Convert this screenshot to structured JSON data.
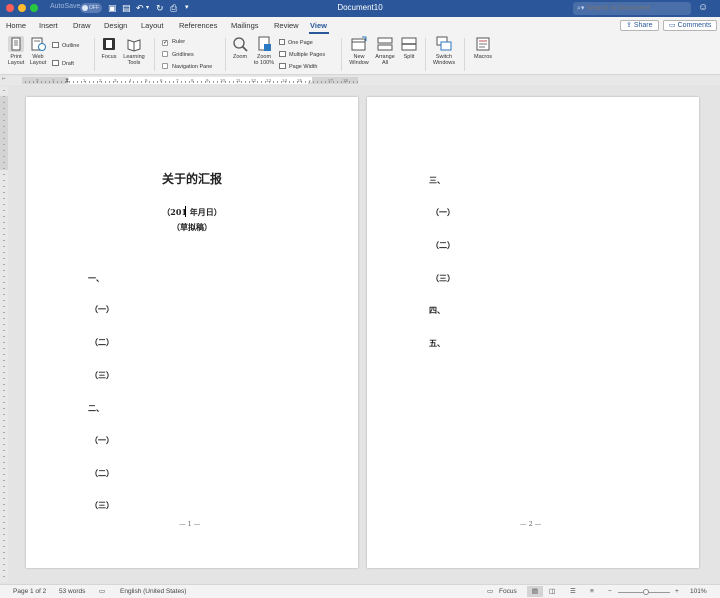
{
  "app": {
    "document_title": "Document10",
    "autosave_label": "AutoSave",
    "autosave_state": "OFF",
    "search_placeholder": "Search in Document"
  },
  "tabs": [
    "Home",
    "Insert",
    "Draw",
    "Design",
    "Layout",
    "References",
    "Mailings",
    "Review",
    "View"
  ],
  "active_tab": "View",
  "header_buttons": {
    "share": "Share",
    "comments": "Comments"
  },
  "ribbon": {
    "print_layout": [
      "Print",
      "Layout"
    ],
    "web_layout": [
      "Web",
      "Layout"
    ],
    "outline": "Outline",
    "draft": "Draft",
    "focus": "Focus",
    "learning_tools": [
      "Learning",
      "Tools"
    ],
    "ruler": "Ruler",
    "ruler_checked": true,
    "gridlines": "Gridlines",
    "gridlines_checked": false,
    "navigation_pane": "Navigation Pane",
    "navigation_pane_checked": false,
    "zoom": "Zoom",
    "zoom_100": [
      "Zoom",
      "to 100%"
    ],
    "one_page": "One Page",
    "multiple_pages": "Multiple Pages",
    "page_width": "Page Width",
    "new_window": [
      "New",
      "Window"
    ],
    "arrange_all": [
      "Arrange",
      "All"
    ],
    "split": "Split",
    "switch_windows": [
      "Switch",
      "Windows"
    ],
    "macros": "Macros"
  },
  "document": {
    "page1": {
      "title": "关于的汇报",
      "date_line": "（201 年月日）",
      "draft_line": "（草拟稿）",
      "items": [
        "一、",
        "（一）",
        "（二）",
        "（三）",
        "二、",
        "（一）",
        "（二）",
        "（三）"
      ],
      "page_number": "— 1 —"
    },
    "page2": {
      "items": [
        "三、",
        "（一）",
        "（二）",
        "（三）",
        "四、",
        "五、"
      ],
      "page_number": "— 2 —"
    }
  },
  "status": {
    "page": "Page 1 of 2",
    "words": "53 words",
    "language": "English (United States)",
    "focus": "Focus",
    "zoom": "101%"
  }
}
